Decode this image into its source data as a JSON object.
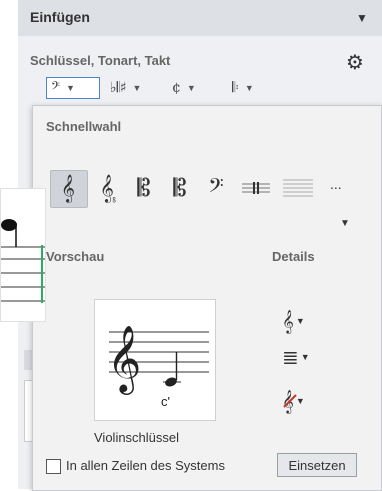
{
  "panel": {
    "title": "Einfügen",
    "collapse_icon": "triangle-down-icon",
    "section_label": "Schlüssel, Tonart, Takt",
    "settings_icon": "gear-icon",
    "toolbar": [
      {
        "icon": "bass-clef-icon",
        "glyph": "𝄢"
      },
      {
        "icon": "key-signature-icon",
        "glyph": "♭𝄃♯"
      },
      {
        "icon": "time-signature-icon",
        "glyph": "¢"
      },
      {
        "icon": "barline-icon",
        "glyph": "𝄆"
      }
    ],
    "dropdown_glyph": "▼"
  },
  "popup": {
    "quick_label": "Schnellwahl",
    "clefs": [
      {
        "name": "treble-clef",
        "glyph": "𝄞"
      },
      {
        "name": "treble-8vb-clef",
        "glyph": "𝄠"
      },
      {
        "name": "alto-clef",
        "glyph": "𝄡"
      },
      {
        "name": "tenor-clef",
        "glyph": "𝄡"
      },
      {
        "name": "bass-clef",
        "glyph": "𝄢"
      },
      {
        "name": "percussion-clef",
        "glyph": "𝄥"
      },
      {
        "name": "tab-clef",
        "glyph": "≡"
      }
    ],
    "more_label": "...",
    "more_arrow": "▼",
    "preview_label": "Vorschau",
    "details_label": "Details",
    "preview_note": "c'",
    "preview_name": "Violinschlüssel",
    "details": [
      {
        "icon": "clef-detail-icon",
        "glyph": "𝄞"
      },
      {
        "icon": "staff-lines-icon",
        "glyph": "≣"
      },
      {
        "icon": "clef-color-icon",
        "glyph": "𝄞"
      }
    ],
    "checkbox_label": "In allen Zeilen des Systems",
    "insert_label": "Einsetzen"
  },
  "colors": {
    "accent": "#4a84d3",
    "panel_bg": "#eef0f3",
    "header_bg": "#dde0e5",
    "score_bar": "#27ae60"
  }
}
